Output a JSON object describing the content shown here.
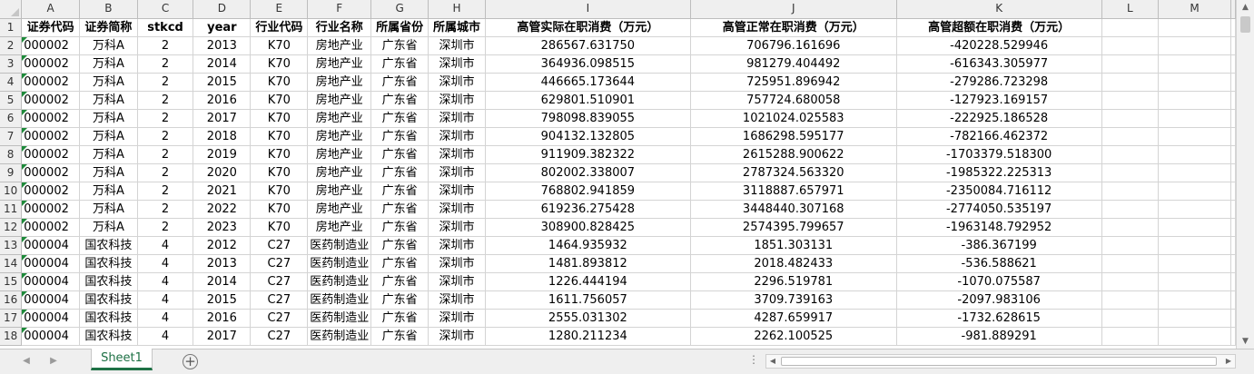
{
  "columns": [
    "A",
    "B",
    "C",
    "D",
    "E",
    "F",
    "G",
    "H",
    "I",
    "J",
    "K",
    "L",
    "M"
  ],
  "headers": [
    "证券代码",
    "证券简称",
    "stkcd",
    "year",
    "行业代码",
    "行业名称",
    "所属省份",
    "所属城市",
    "高管实际在职消费（万元）",
    "高管正常在职消费（万元）",
    "高管超额在职消费（万元）",
    "",
    ""
  ],
  "rows": [
    {
      "num": "2",
      "cells": [
        "000002",
        "万科A",
        "2",
        "2013",
        "K70",
        "房地产业",
        "广东省",
        "深圳市",
        "286567.631750",
        "706796.161696",
        "-420228.529946",
        "",
        ""
      ]
    },
    {
      "num": "3",
      "cells": [
        "000002",
        "万科A",
        "2",
        "2014",
        "K70",
        "房地产业",
        "广东省",
        "深圳市",
        "364936.098515",
        "981279.404492",
        "-616343.305977",
        "",
        ""
      ]
    },
    {
      "num": "4",
      "cells": [
        "000002",
        "万科A",
        "2",
        "2015",
        "K70",
        "房地产业",
        "广东省",
        "深圳市",
        "446665.173644",
        "725951.896942",
        "-279286.723298",
        "",
        ""
      ]
    },
    {
      "num": "5",
      "cells": [
        "000002",
        "万科A",
        "2",
        "2016",
        "K70",
        "房地产业",
        "广东省",
        "深圳市",
        "629801.510901",
        "757724.680058",
        "-127923.169157",
        "",
        ""
      ]
    },
    {
      "num": "6",
      "cells": [
        "000002",
        "万科A",
        "2",
        "2017",
        "K70",
        "房地产业",
        "广东省",
        "深圳市",
        "798098.839055",
        "1021024.025583",
        "-222925.186528",
        "",
        ""
      ]
    },
    {
      "num": "7",
      "cells": [
        "000002",
        "万科A",
        "2",
        "2018",
        "K70",
        "房地产业",
        "广东省",
        "深圳市",
        "904132.132805",
        "1686298.595177",
        "-782166.462372",
        "",
        ""
      ]
    },
    {
      "num": "8",
      "cells": [
        "000002",
        "万科A",
        "2",
        "2019",
        "K70",
        "房地产业",
        "广东省",
        "深圳市",
        "911909.382322",
        "2615288.900622",
        "-1703379.518300",
        "",
        ""
      ]
    },
    {
      "num": "9",
      "cells": [
        "000002",
        "万科A",
        "2",
        "2020",
        "K70",
        "房地产业",
        "广东省",
        "深圳市",
        "802002.338007",
        "2787324.563320",
        "-1985322.225313",
        "",
        ""
      ]
    },
    {
      "num": "10",
      "cells": [
        "000002",
        "万科A",
        "2",
        "2021",
        "K70",
        "房地产业",
        "广东省",
        "深圳市",
        "768802.941859",
        "3118887.657971",
        "-2350084.716112",
        "",
        ""
      ]
    },
    {
      "num": "11",
      "cells": [
        "000002",
        "万科A",
        "2",
        "2022",
        "K70",
        "房地产业",
        "广东省",
        "深圳市",
        "619236.275428",
        "3448440.307168",
        "-2774050.535197",
        "",
        ""
      ]
    },
    {
      "num": "12",
      "cells": [
        "000002",
        "万科A",
        "2",
        "2023",
        "K70",
        "房地产业",
        "广东省",
        "深圳市",
        "308900.828425",
        "2574395.799657",
        "-1963148.792952",
        "",
        ""
      ]
    },
    {
      "num": "13",
      "cells": [
        "000004",
        "国农科技",
        "4",
        "2012",
        "C27",
        "医药制造业",
        "广东省",
        "深圳市",
        "1464.935932",
        "1851.303131",
        "-386.367199",
        "",
        ""
      ]
    },
    {
      "num": "14",
      "cells": [
        "000004",
        "国农科技",
        "4",
        "2013",
        "C27",
        "医药制造业",
        "广东省",
        "深圳市",
        "1481.893812",
        "2018.482433",
        "-536.588621",
        "",
        ""
      ]
    },
    {
      "num": "15",
      "cells": [
        "000004",
        "国农科技",
        "4",
        "2014",
        "C27",
        "医药制造业",
        "广东省",
        "深圳市",
        "1226.444194",
        "2296.519781",
        "-1070.075587",
        "",
        ""
      ]
    },
    {
      "num": "16",
      "cells": [
        "000004",
        "国农科技",
        "4",
        "2015",
        "C27",
        "医药制造业",
        "广东省",
        "深圳市",
        "1611.756057",
        "3709.739163",
        "-2097.983106",
        "",
        ""
      ]
    },
    {
      "num": "17",
      "cells": [
        "000004",
        "国农科技",
        "4",
        "2016",
        "C27",
        "医药制造业",
        "广东省",
        "深圳市",
        "2555.031302",
        "4287.659917",
        "-1732.628615",
        "",
        ""
      ]
    },
    {
      "num": "18",
      "cells": [
        "000004",
        "国农科技",
        "4",
        "2017",
        "C27",
        "医药制造业",
        "广东省",
        "深圳市",
        "1280.211234",
        "2262.100525",
        "-981.889291",
        "",
        ""
      ]
    }
  ],
  "sheet_tab": "Sheet1",
  "add_sheet_label": "+",
  "hscroll_dots": "⋮",
  "icons": {
    "scroll_up": "▲",
    "scroll_down": "▼",
    "scroll_left": "◀",
    "scroll_right": "▶",
    "tab_prev": "◀",
    "tab_next": "▶"
  },
  "colors": {
    "sheet_tab_accent": "#1e7145",
    "text_marker": "#1e8a3a"
  }
}
